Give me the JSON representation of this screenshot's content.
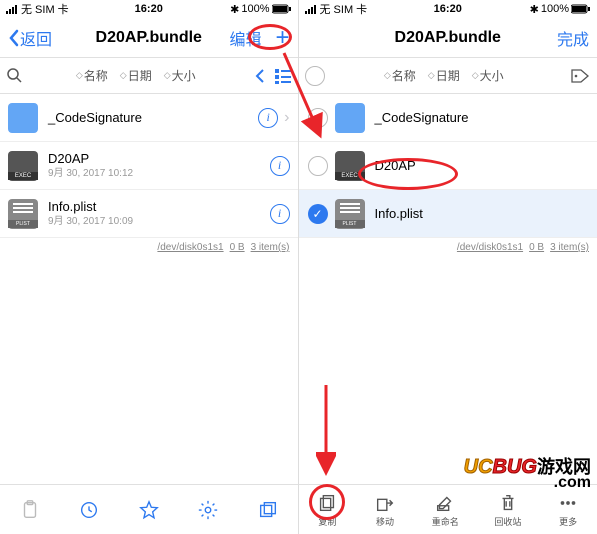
{
  "status": {
    "carrier": "无 SIM 卡",
    "time": "16:20",
    "bt": "✱",
    "battery": "100%"
  },
  "left": {
    "nav": {
      "back": "返回",
      "title": "D20AP.bundle",
      "edit": "编辑",
      "plus": "+"
    },
    "sort": {
      "name": "名称",
      "date": "日期",
      "size": "大小"
    },
    "rows": [
      {
        "name": "_CodeSignature",
        "sub": ""
      },
      {
        "name": "D20AP",
        "sub": "9月 30, 2017 10:12"
      },
      {
        "name": "Info.plist",
        "sub": "9月 30, 2017 10:09"
      }
    ],
    "summary": {
      "dev": "/dev/disk0s1s1",
      "size": "0 B",
      "count": "3 item(s)"
    }
  },
  "right": {
    "nav": {
      "title": "D20AP.bundle",
      "done": "完成"
    },
    "sort": {
      "name": "名称",
      "date": "日期",
      "size": "大小"
    },
    "rows": [
      {
        "name": "_CodeSignature"
      },
      {
        "name": "D20AP"
      },
      {
        "name": "Info.plist"
      }
    ],
    "summary": {
      "dev": "/dev/disk0s1s1",
      "size": "0 B",
      "count": "3 item(s)"
    },
    "toolbar": {
      "copy": "复制",
      "move": "移动",
      "rename": "重命名",
      "trash": "回收站",
      "more": "更多"
    }
  },
  "watermark": {
    "uc": "UC",
    "bug": "BUG",
    "cn": "游戏网",
    "com": ".com"
  }
}
